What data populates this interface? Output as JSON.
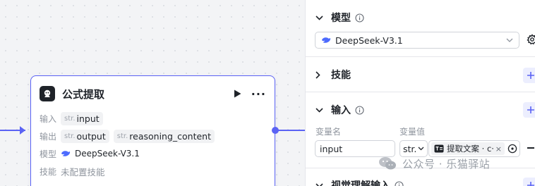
{
  "node": {
    "title": "公式提取",
    "rows": {
      "input_label": "输入",
      "input_vars": [
        {
          "type": "str.",
          "name": "input"
        }
      ],
      "output_label": "输出",
      "output_vars": [
        {
          "type": "str.",
          "name": "output"
        },
        {
          "type": "str.",
          "name": "reasoning_content"
        }
      ],
      "model_label": "模型",
      "model_value": "DeepSeek-V3.1",
      "skill_label": "技能",
      "skill_value": "未配置技能"
    }
  },
  "panel": {
    "model_section": {
      "title": "模型",
      "selected_model": "DeepSeek-V3.1"
    },
    "skills_section": {
      "title": "技能"
    },
    "input_section": {
      "title": "输入",
      "col_name": "变量名",
      "col_value": "变量值",
      "row": {
        "name": "input",
        "type": "str.",
        "ref_text": "提取文案 · c··",
        "ref_close": "×"
      }
    },
    "visual_section": {
      "title": "视觉理解输入"
    }
  },
  "watermark": {
    "text": "公众号 · 乐猫驿站"
  },
  "colors": {
    "accent": "#5b63f4",
    "deepseek_blue": "#4d6bfe"
  }
}
